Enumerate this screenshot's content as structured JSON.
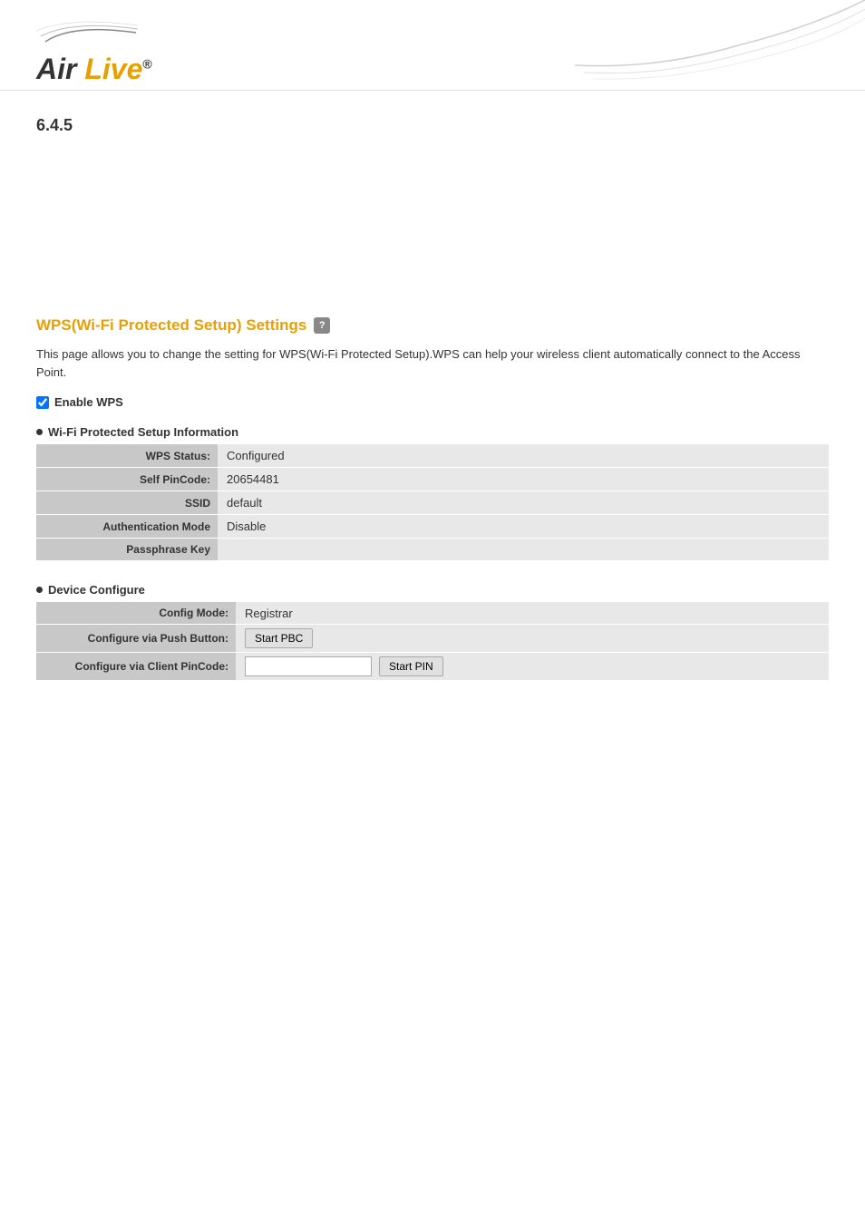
{
  "header": {
    "logo_air": "Air",
    "logo_live": "Live",
    "logo_reg": "®"
  },
  "version": {
    "label": "6.4.5"
  },
  "page": {
    "title": "WPS(Wi-Fi Protected Setup) Settings",
    "help_icon_label": "?",
    "description": "This page allows you to change the setting for WPS(Wi-Fi Protected Setup).WPS can help your wireless client automatically connect to the Access Point.",
    "enable_wps_label": "Enable WPS",
    "enable_wps_checked": true
  },
  "wps_info": {
    "section_title": "Wi-Fi Protected Setup Information",
    "rows": [
      {
        "label": "WPS Status:",
        "value": "Configured"
      },
      {
        "label": "Self PinCode:",
        "value": "20654481"
      },
      {
        "label": "SSID",
        "value": "default"
      },
      {
        "label": "Authentication Mode",
        "value": "Disable"
      },
      {
        "label": "Passphrase Key",
        "value": ""
      }
    ]
  },
  "device_configure": {
    "section_title": "Device Configure",
    "config_mode_label": "Config Mode:",
    "config_mode_value": "Registrar",
    "push_button_label": "Configure via Push Button:",
    "push_button_btn": "Start PBC",
    "client_pin_label": "Configure via Client PinCode:",
    "client_pin_placeholder": "",
    "client_pin_btn": "Start PIN"
  }
}
